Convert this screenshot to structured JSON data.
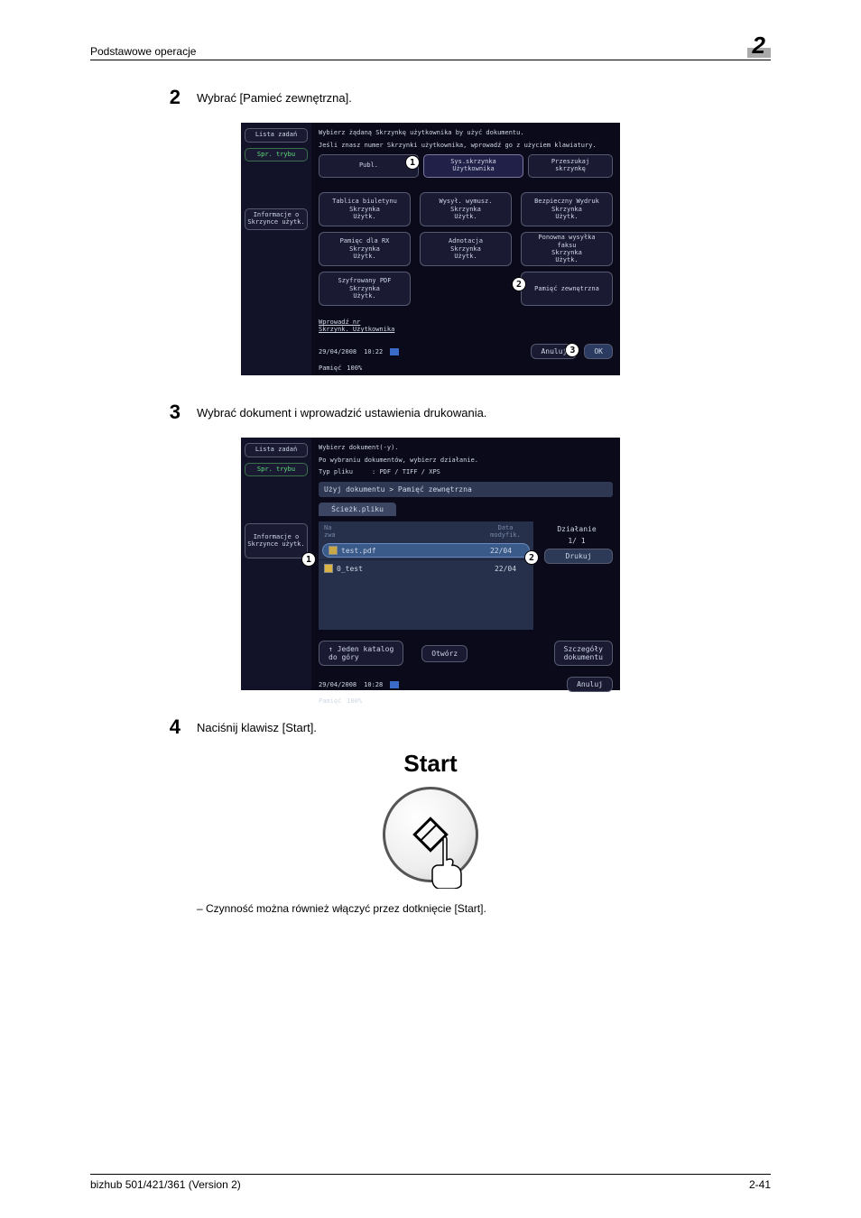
{
  "header": {
    "section_title": "Podstawowe operacje",
    "chapter": "2"
  },
  "steps": {
    "s2": {
      "num": "2",
      "text": "Wybrać [Pamieć zewnętrzna]."
    },
    "s3": {
      "num": "3",
      "text": "Wybrać dokument i wprowadzić ustawienia drukowania."
    },
    "s4": {
      "num": "4",
      "text": "Naciśnij klawisz [Start]."
    }
  },
  "bullet_text": "–   Czynność można również włączyć przez dotknięcie [Start].",
  "start_label": "Start",
  "callouts": {
    "one": "1",
    "two": "2",
    "three": "3"
  },
  "screen1": {
    "instr1": "Wybierz żądaną Skrzynkę użytkownika by użyć dokumentu.",
    "instr2": "Jeśli znasz numer Skrzynki użytkownika, wprowadź go z użyciem klawiatury.",
    "left": {
      "lista": "Lista zadań",
      "spr": "Spr. trybu",
      "info": "Informacje o\nSkrzynce użytk."
    },
    "tabs": {
      "publ": "Publ.",
      "sys": "Sys.skrzynka\nUżytkownika",
      "prz": "Przeszukaj\nskrzynkę"
    },
    "tiles": {
      "tablica": "Tablica biuletynu\nSkrzynka\nUżytk.",
      "wysyl": "Wysył. wymusz.\nSkrzynka\nUżytk.",
      "bezp": "Bezpieczny Wydruk\nSkrzynka\nUżytk.",
      "pamrx": "Pamięc dla RX\nSkrzynka\nUżytk.",
      "adnot": "Adnotacja\nSkrzynka\nUżytk.",
      "ponowna": "Ponowna wysyłka\nfaksu\nSkrzynka\nUżytk.",
      "szyfr": "Szyfrowany PDF\nSkrzynka\nUżytk.",
      "pamzew": "Pamięć zewnętrzna"
    },
    "hint": "Wprowadź nr\nSkrzynk. Użytkownika",
    "footer": {
      "date": "29/04/2008",
      "time": "10:22",
      "mem": "Pamięć",
      "pct": "100%",
      "cancel": "Anuluj",
      "ok": "OK"
    }
  },
  "screen2": {
    "instr1": "Wybierz dokument(-y).",
    "instr2": "Po wybraniu dokumentów, wybierz działanie.",
    "instr3": "Typ pliku",
    "instr3b": ": PDF / TIFF / XPS",
    "left": {
      "lista": "Lista zadań",
      "spr": "Spr. trybu",
      "info": "Informacje o\nSkrzynce użytk."
    },
    "breadcrumb": "Użyj dokumentu > Pamięć zewnętrzna",
    "path": "Ścieżk.pliku",
    "cols": {
      "name": "Na\nzwa",
      "date": "Data\nmodyfik."
    },
    "files": {
      "f1": "test.pdf",
      "d1": "22/04",
      "f2": "0_test",
      "d2": "22/04"
    },
    "actions": {
      "header": "Działanie",
      "page": "1/  1",
      "print": "Drukuj"
    },
    "buttons": {
      "up": "Jeden katalog\ndo góry",
      "open": "Otwórz",
      "detail": "Szczegóły\ndokumentu",
      "cancel": "Anuluj"
    },
    "footer": {
      "date": "29/04/2008",
      "time": "10:28",
      "mem": "Pamięć",
      "pct": "100%"
    }
  },
  "footer": {
    "left": "bizhub 501/421/361 (Version 2)",
    "right": "2-41"
  }
}
